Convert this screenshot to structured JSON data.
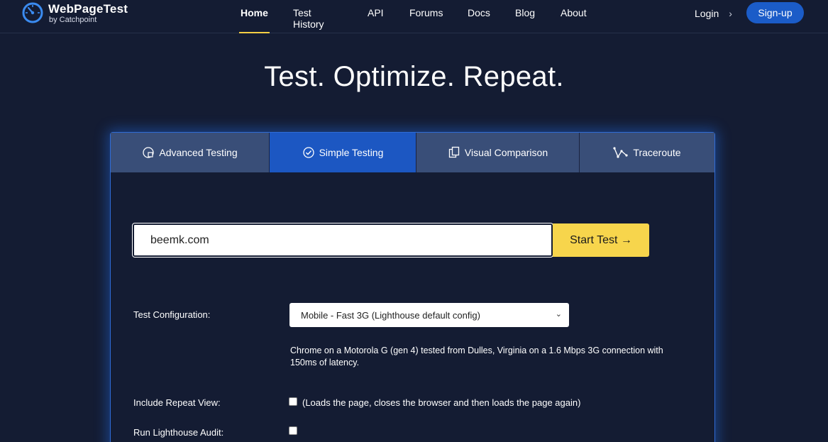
{
  "brand": {
    "name": "WebPageTest",
    "by": "by Catchpoint"
  },
  "nav": {
    "items": [
      "Home",
      "Test History",
      "API",
      "Forums",
      "Docs",
      "Blog",
      "About"
    ],
    "active": "Home",
    "login": "Login",
    "signup": "Sign-up"
  },
  "hero": {
    "title": "Test. Optimize. Repeat."
  },
  "tabs": [
    "Advanced Testing",
    "Simple Testing",
    "Visual Comparison",
    "Traceroute"
  ],
  "active_tab": "Simple Testing",
  "url_input": {
    "value": "beemk.com"
  },
  "start_button": "Start Test →",
  "config": {
    "label": "Test Configuration:",
    "selected": "Mobile - Fast 3G (Lighthouse default config)",
    "description": "Chrome on a Motorola G (gen 4) tested from Dulles, Virginia on a 1.6 Mbps 3G connection with 150ms of latency."
  },
  "repeat_view": {
    "label": "Include Repeat View:",
    "note": "(Loads the page, closes the browser and then loads the page again)",
    "checked": false
  },
  "lighthouse": {
    "label": "Run Lighthouse Audit:",
    "checked": false
  },
  "colors": {
    "background": "#141c33",
    "accent_yellow": "#f7d54c",
    "active_tab": "#1c57c2",
    "tab": "#394e78",
    "signup": "#1b5cc8"
  }
}
